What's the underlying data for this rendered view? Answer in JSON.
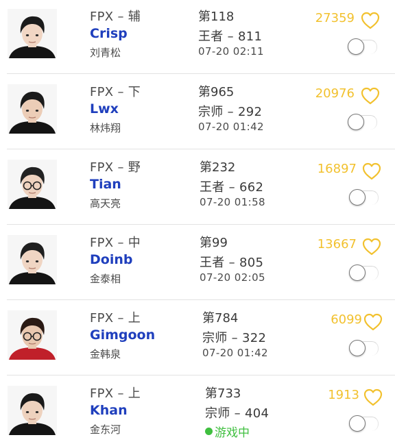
{
  "theme": {
    "name_color": "#1f3fbd",
    "likes_color": "#f2c12e",
    "online_color": "#3fbf3f"
  },
  "players": [
    {
      "team_role": "FPX – 辅",
      "name": "Crisp",
      "real_name": "刘青松",
      "rank": "第118",
      "tier": "王者 – 811",
      "time": "07-20 02:11",
      "likes": "27359",
      "avatar_icon": "player-photo-icon"
    },
    {
      "team_role": "FPX – 下",
      "name": "Lwx",
      "real_name": "林炜翔",
      "rank": "第965",
      "tier": "宗师 – 292",
      "time": "07-20 01:42",
      "likes": "20976",
      "avatar_icon": "player-photo-icon"
    },
    {
      "team_role": "FPX – 野",
      "name": "Tian",
      "real_name": "高天亮",
      "rank": "第232",
      "tier": "王者 – 662",
      "time": "07-20 01:58",
      "likes": "16897",
      "avatar_icon": "player-photo-icon"
    },
    {
      "team_role": "FPX – 中",
      "name": "Doinb",
      "real_name": "金泰相",
      "rank": "第99",
      "tier": "王者 – 805",
      "time": "07-20 02:05",
      "likes": "13667",
      "avatar_icon": "player-photo-icon"
    },
    {
      "team_role": "FPX – 上",
      "name": "Gimgoon",
      "real_name": "金韩泉",
      "rank": "第784",
      "tier": "宗师 – 322",
      "time": "07-20 01:42",
      "likes": "6099",
      "avatar_icon": "player-photo-icon"
    },
    {
      "team_role": "FPX – 上",
      "name": "Khan",
      "real_name": "金东河",
      "rank": "第733",
      "tier": "宗师 – 404",
      "status": "游戏中",
      "likes": "1913",
      "avatar_icon": "player-photo-icon"
    }
  ]
}
